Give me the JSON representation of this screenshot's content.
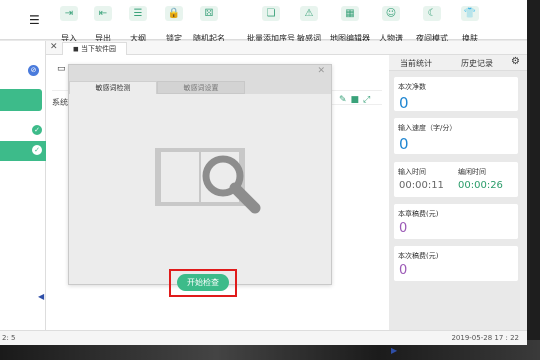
{
  "toolbar": {
    "items": [
      {
        "label": "导入",
        "icon": "import-icon",
        "glyph": "⇥"
      },
      {
        "label": "导出",
        "icon": "export-icon",
        "glyph": "⇤"
      },
      {
        "label": "大纲",
        "icon": "outline-icon",
        "glyph": "☰"
      },
      {
        "label": "锁定",
        "icon": "lock-icon",
        "glyph": "🔒"
      },
      {
        "label": "随机起名",
        "icon": "random-name-icon",
        "glyph": "⚄"
      },
      {
        "label": "批量添加序号",
        "icon": "batch-number-icon",
        "glyph": "❏"
      },
      {
        "label": "敏感词",
        "icon": "warning-icon",
        "glyph": "⚠"
      },
      {
        "label": "地图编辑器",
        "icon": "map-icon",
        "glyph": "▦"
      },
      {
        "label": "人物谱",
        "icon": "person-icon",
        "glyph": "☺"
      },
      {
        "label": "夜间模式",
        "icon": "moon-icon",
        "glyph": "☾"
      },
      {
        "label": "换肤",
        "icon": "shirt-icon",
        "glyph": "👕"
      }
    ]
  },
  "tab": {
    "close": "✕",
    "title": "◼ 当下软件园"
  },
  "editor": {
    "sys_text": "系统"
  },
  "dialog": {
    "close": "✕",
    "tabs": [
      {
        "label": "敏感词检测"
      },
      {
        "label": "敏感词设置"
      }
    ],
    "start_button": "开始检查"
  },
  "right_panel": {
    "tabs": [
      "当前统计",
      "历史记录"
    ],
    "stats": {
      "this_count_label": "本次净数",
      "this_count_value": "0",
      "speed_label": "输入速度（字/分）",
      "speed_value": "0",
      "input_time_label": "输入时间",
      "input_time_value": "00:00:11",
      "idle_time_label": "编闲时间",
      "idle_time_value": "00:00:26",
      "chapter_fee_label": "本章稿费(元)",
      "chapter_fee_value": "0",
      "this_fee_label": "本次稿费(元)",
      "this_fee_value": "0"
    }
  },
  "statusbar": {
    "left": "2: 5",
    "right": "2019-05-28 17 : 22"
  },
  "colors": {
    "accent_green": "#3dbb8a",
    "value_blue": "#1f86d1",
    "value_purple": "#9b59b6",
    "highlight_red": "#e01b1b"
  }
}
